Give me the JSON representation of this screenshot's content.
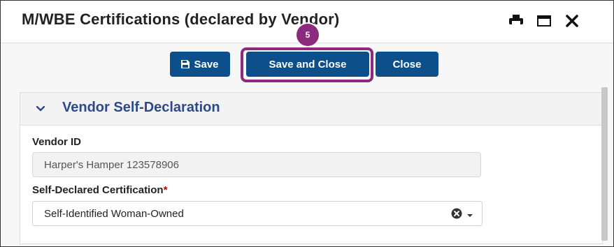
{
  "dialog": {
    "title": "M/WBE Certifications (declared by Vendor)",
    "title_icons": [
      "print-icon",
      "maximize-icon",
      "close-icon"
    ]
  },
  "toolbar": {
    "save_label": "Save",
    "save_close_label": "Save and Close",
    "close_label": "Close"
  },
  "annotation": {
    "step_number": "5",
    "color": "#8c2a7e"
  },
  "panel": {
    "title": "Vendor Self-Declaration",
    "fields": {
      "vendor_id": {
        "label": "Vendor ID",
        "value": "Harper's Hamper 123578906"
      },
      "certification": {
        "label": "Self-Declared Certification",
        "required_marker": "*",
        "value": "Self-Identified Woman-Owned"
      }
    }
  },
  "colors": {
    "button_bg": "#0d4f8b",
    "panel_title": "#2c4a8a",
    "required": "#cc0000"
  }
}
